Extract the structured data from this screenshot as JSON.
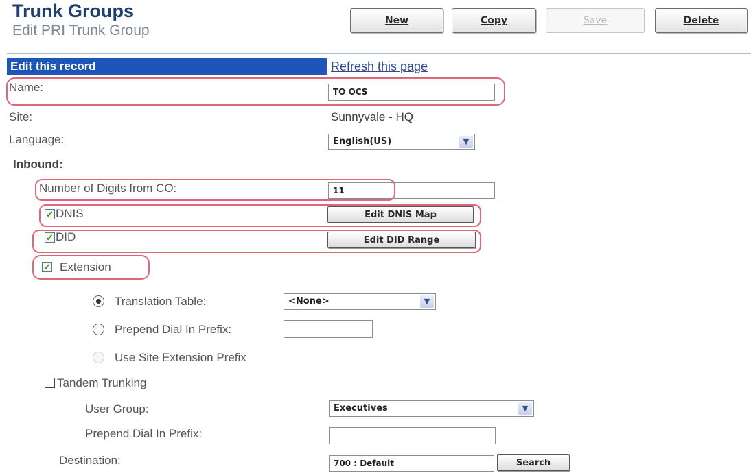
{
  "header": {
    "title": "Trunk Groups",
    "subtitle": "Edit PRI Trunk Group"
  },
  "toolbar": {
    "new_label": "New",
    "copy_label": "Copy",
    "save_label": "Save",
    "delete_label": "Delete"
  },
  "form_header": {
    "edit_label": "Edit this record",
    "refresh_label": "Refresh this page"
  },
  "fields": {
    "name_label": "Name:",
    "name_value": "TO OCS",
    "site_label": "Site:",
    "site_value": "Sunnyvale - HQ",
    "language_label": "Language:",
    "language_value": "English(US)"
  },
  "inbound": {
    "heading": "Inbound:",
    "digits_label": "Number of Digits from CO:",
    "digits_value": "11",
    "dnis_label": "DNIS",
    "dnis_checked": true,
    "dnis_button": "Edit DNIS Map",
    "did_label": "DID",
    "did_checked": true,
    "did_button": "Edit DID Range",
    "extension_label": "Extension",
    "extension_checked": true,
    "translation_label": "Translation Table:",
    "translation_value": "<None>",
    "prepend_label": "Prepend Dial In Prefix:",
    "site_prefix_label": "Use Site Extension Prefix",
    "tandem_label": "Tandem Trunking",
    "tandem_checked": false,
    "user_group_label": "User Group:",
    "user_group_value": "Executives",
    "prepend2_label": "Prepend Dial In Prefix:",
    "destination_label": "Destination:",
    "destination_value": "700 : Default",
    "search_button": "Search"
  },
  "icons": {
    "dropdown": "chevron-down-icon",
    "checkbox": "checkmark-icon",
    "radio": "radio-icon"
  },
  "colors": {
    "accent": "#1d56b8",
    "title": "#1f3f6e",
    "highlight": "#e0677a",
    "check": "#3a8a2a"
  }
}
